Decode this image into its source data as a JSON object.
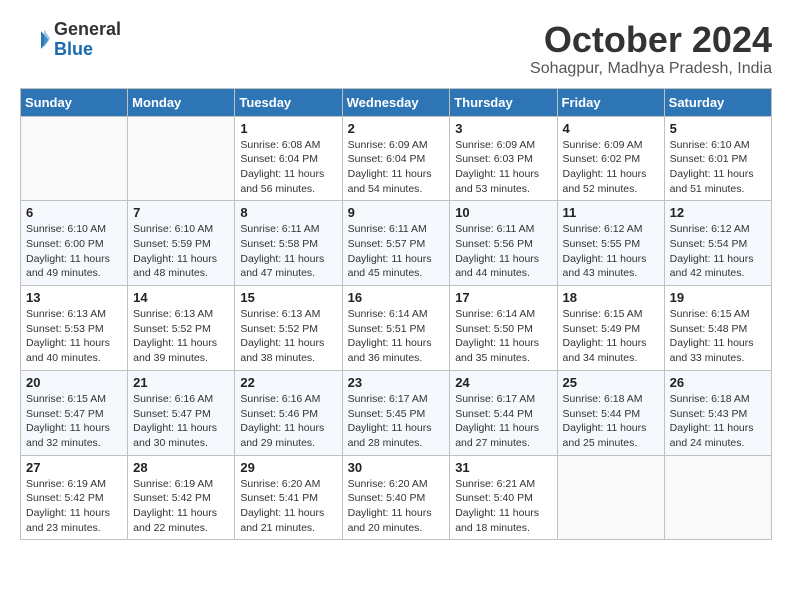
{
  "header": {
    "logo_general": "General",
    "logo_blue": "Blue",
    "month": "October 2024",
    "location": "Sohagpur, Madhya Pradesh, India"
  },
  "weekdays": [
    "Sunday",
    "Monday",
    "Tuesday",
    "Wednesday",
    "Thursday",
    "Friday",
    "Saturday"
  ],
  "weeks": [
    [
      {
        "day": "",
        "info": ""
      },
      {
        "day": "",
        "info": ""
      },
      {
        "day": "1",
        "info": "Sunrise: 6:08 AM\nSunset: 6:04 PM\nDaylight: 11 hours and 56 minutes."
      },
      {
        "day": "2",
        "info": "Sunrise: 6:09 AM\nSunset: 6:04 PM\nDaylight: 11 hours and 54 minutes."
      },
      {
        "day": "3",
        "info": "Sunrise: 6:09 AM\nSunset: 6:03 PM\nDaylight: 11 hours and 53 minutes."
      },
      {
        "day": "4",
        "info": "Sunrise: 6:09 AM\nSunset: 6:02 PM\nDaylight: 11 hours and 52 minutes."
      },
      {
        "day": "5",
        "info": "Sunrise: 6:10 AM\nSunset: 6:01 PM\nDaylight: 11 hours and 51 minutes."
      }
    ],
    [
      {
        "day": "6",
        "info": "Sunrise: 6:10 AM\nSunset: 6:00 PM\nDaylight: 11 hours and 49 minutes."
      },
      {
        "day": "7",
        "info": "Sunrise: 6:10 AM\nSunset: 5:59 PM\nDaylight: 11 hours and 48 minutes."
      },
      {
        "day": "8",
        "info": "Sunrise: 6:11 AM\nSunset: 5:58 PM\nDaylight: 11 hours and 47 minutes."
      },
      {
        "day": "9",
        "info": "Sunrise: 6:11 AM\nSunset: 5:57 PM\nDaylight: 11 hours and 45 minutes."
      },
      {
        "day": "10",
        "info": "Sunrise: 6:11 AM\nSunset: 5:56 PM\nDaylight: 11 hours and 44 minutes."
      },
      {
        "day": "11",
        "info": "Sunrise: 6:12 AM\nSunset: 5:55 PM\nDaylight: 11 hours and 43 minutes."
      },
      {
        "day": "12",
        "info": "Sunrise: 6:12 AM\nSunset: 5:54 PM\nDaylight: 11 hours and 42 minutes."
      }
    ],
    [
      {
        "day": "13",
        "info": "Sunrise: 6:13 AM\nSunset: 5:53 PM\nDaylight: 11 hours and 40 minutes."
      },
      {
        "day": "14",
        "info": "Sunrise: 6:13 AM\nSunset: 5:52 PM\nDaylight: 11 hours and 39 minutes."
      },
      {
        "day": "15",
        "info": "Sunrise: 6:13 AM\nSunset: 5:52 PM\nDaylight: 11 hours and 38 minutes."
      },
      {
        "day": "16",
        "info": "Sunrise: 6:14 AM\nSunset: 5:51 PM\nDaylight: 11 hours and 36 minutes."
      },
      {
        "day": "17",
        "info": "Sunrise: 6:14 AM\nSunset: 5:50 PM\nDaylight: 11 hours and 35 minutes."
      },
      {
        "day": "18",
        "info": "Sunrise: 6:15 AM\nSunset: 5:49 PM\nDaylight: 11 hours and 34 minutes."
      },
      {
        "day": "19",
        "info": "Sunrise: 6:15 AM\nSunset: 5:48 PM\nDaylight: 11 hours and 33 minutes."
      }
    ],
    [
      {
        "day": "20",
        "info": "Sunrise: 6:15 AM\nSunset: 5:47 PM\nDaylight: 11 hours and 32 minutes."
      },
      {
        "day": "21",
        "info": "Sunrise: 6:16 AM\nSunset: 5:47 PM\nDaylight: 11 hours and 30 minutes."
      },
      {
        "day": "22",
        "info": "Sunrise: 6:16 AM\nSunset: 5:46 PM\nDaylight: 11 hours and 29 minutes."
      },
      {
        "day": "23",
        "info": "Sunrise: 6:17 AM\nSunset: 5:45 PM\nDaylight: 11 hours and 28 minutes."
      },
      {
        "day": "24",
        "info": "Sunrise: 6:17 AM\nSunset: 5:44 PM\nDaylight: 11 hours and 27 minutes."
      },
      {
        "day": "25",
        "info": "Sunrise: 6:18 AM\nSunset: 5:44 PM\nDaylight: 11 hours and 25 minutes."
      },
      {
        "day": "26",
        "info": "Sunrise: 6:18 AM\nSunset: 5:43 PM\nDaylight: 11 hours and 24 minutes."
      }
    ],
    [
      {
        "day": "27",
        "info": "Sunrise: 6:19 AM\nSunset: 5:42 PM\nDaylight: 11 hours and 23 minutes."
      },
      {
        "day": "28",
        "info": "Sunrise: 6:19 AM\nSunset: 5:42 PM\nDaylight: 11 hours and 22 minutes."
      },
      {
        "day": "29",
        "info": "Sunrise: 6:20 AM\nSunset: 5:41 PM\nDaylight: 11 hours and 21 minutes."
      },
      {
        "day": "30",
        "info": "Sunrise: 6:20 AM\nSunset: 5:40 PM\nDaylight: 11 hours and 20 minutes."
      },
      {
        "day": "31",
        "info": "Sunrise: 6:21 AM\nSunset: 5:40 PM\nDaylight: 11 hours and 18 minutes."
      },
      {
        "day": "",
        "info": ""
      },
      {
        "day": "",
        "info": ""
      }
    ]
  ]
}
